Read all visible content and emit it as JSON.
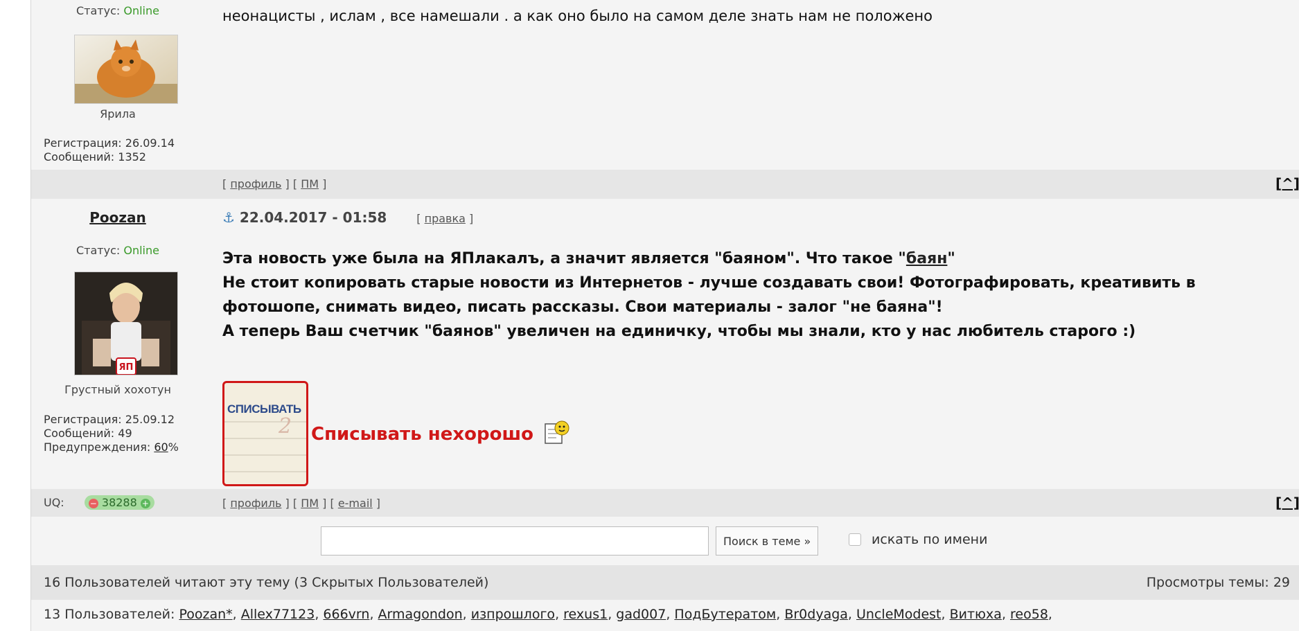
{
  "post1": {
    "status_label": "Статус:",
    "status_value": "Online",
    "avatar_caption": "Ярила",
    "reg_line": "Регистрация: 26.09.14",
    "msgs_line": "Сообщений: 1352",
    "text": "неонацисты , ислам , все намешали . а как оно было на самом деле знать нам не положено",
    "links": {
      "profile": "профиль",
      "pm": "ПМ"
    },
    "up": "[^]"
  },
  "post2": {
    "author": "Poozan",
    "date": "22.04.2017 - 01:58",
    "edit_label": "правка",
    "status_label": "Статус:",
    "status_value": "Online",
    "avatar_caption": "Грустный хохотун",
    "reg_line": "Регистрация: 25.09.12",
    "msgs_line": "Сообщений: 49",
    "warn_label": "Предупреждения:",
    "warn_value": "60",
    "warn_suffix": "%",
    "line1_pre": "Эта новость уже была на ЯПлакалъ, а значит является \"баяном\". Что такое \"",
    "line1_link": "баян",
    "line1_post": "\"",
    "line2": "Не стоит копировать старые новости из Интернетов - лучше создавать свои! Фотографировать, креативить в",
    "line3": "фотошопе, снимать видео, писать рассказы. Свои материалы - залог \"не баяна\"!",
    "line4": "А теперь Ваш счетчик \"баянов\" увеличен на единичку, чтобы мы знали, кто у нас любитель старого :)",
    "sticker_text": "СПИСЫВАТЬ",
    "warning_text": "Списывать нехорошо",
    "uq_label": "UQ:",
    "uq_minus": "−",
    "uq_value": "38288",
    "uq_plus": "+",
    "links": {
      "profile": "профиль",
      "pm": "ПМ",
      "email": "e-mail"
    },
    "up": "[^]"
  },
  "search": {
    "input_value": "",
    "button_label": "Поиск в теме »",
    "checkbox_label": "искать по имени"
  },
  "readers": {
    "summary": "16 Пользователей читают эту тему (3 Скрытых Пользователей)",
    "views_label": "Просмотры темы: 29",
    "users_prefix": "13 Пользователей:",
    "users": [
      "Poozan*",
      "Allex77123",
      "666vrn",
      "Armagondon",
      "изпрошлого",
      "rexus1",
      "gad007",
      "ПодБутератом",
      "Br0dyaga",
      "UncleModest",
      "Витюха",
      "reo58"
    ]
  },
  "colors": {
    "online": "#3a9a2a",
    "warning_red": "#d01818",
    "anchor_blue": "#3f7fb8",
    "uq_badge": "#a8dca0"
  }
}
